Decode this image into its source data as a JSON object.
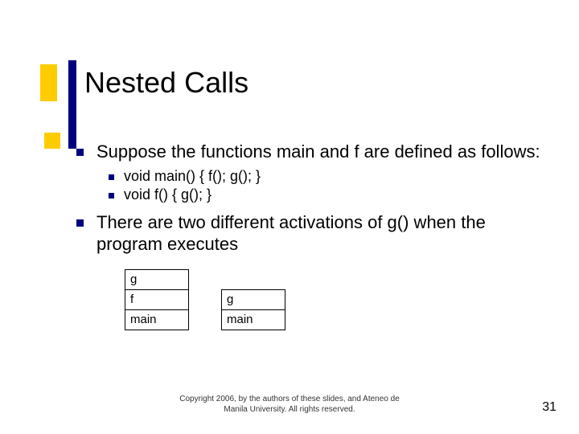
{
  "title": "Nested Calls",
  "bullets": {
    "intro": "Suppose the functions main and f are defined as follows:",
    "code1": "void main() { f(); g(); }",
    "code2": "void f() { g(); }",
    "conclusion": "There are two different activations of g() when the program executes"
  },
  "stacks": {
    "left": [
      "g",
      "f",
      "main"
    ],
    "right": [
      "g",
      "main"
    ]
  },
  "footer_line1": "Copyright 2006, by the authors of these slides, and Ateneo de",
  "footer_line2": "Manila University. All rights reserved.",
  "page_number": "31"
}
